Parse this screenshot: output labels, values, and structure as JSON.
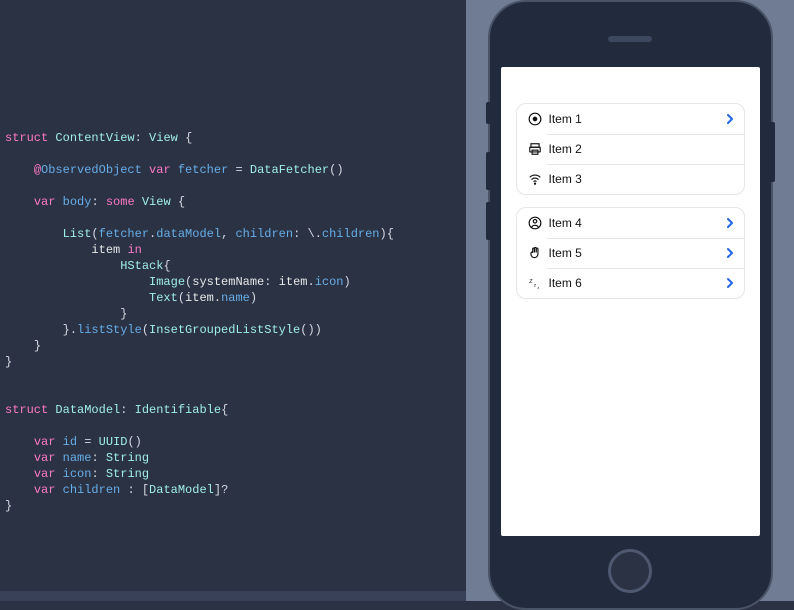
{
  "code": {
    "lines": [
      "",
      "",
      "struct ContentView: View {",
      "",
      "    @ObservedObject var fetcher = DataFetcher()",
      "",
      "    var body: some View {",
      "",
      "        List(fetcher.dataModel, children: \\.children){",
      "            item in",
      "                HStack{",
      "                    Image(systemName: item.icon)",
      "                    Text(item.name)",
      "                }",
      "        }.listStyle(InsetGroupedListStyle())",
      "    }",
      "}",
      "",
      "",
      "struct DataModel: Identifiable{",
      "",
      "    var id = UUID()",
      "    var name: String",
      "    var icon: String",
      "    var children : [DataModel]?",
      "}"
    ]
  },
  "preview": {
    "groups": [
      {
        "items": [
          {
            "icon": "recordingtape",
            "label": "Item 1",
            "disclosure": true
          },
          {
            "icon": "printer",
            "label": "Item 2",
            "disclosure": false
          },
          {
            "icon": "wifi",
            "label": "Item 3",
            "disclosure": false
          }
        ]
      },
      {
        "items": [
          {
            "icon": "person-circle",
            "label": "Item 4",
            "disclosure": true
          },
          {
            "icon": "hand-raised",
            "label": "Item 5",
            "disclosure": true
          },
          {
            "icon": "zzz",
            "label": "Item 6",
            "disclosure": true
          }
        ]
      }
    ]
  }
}
